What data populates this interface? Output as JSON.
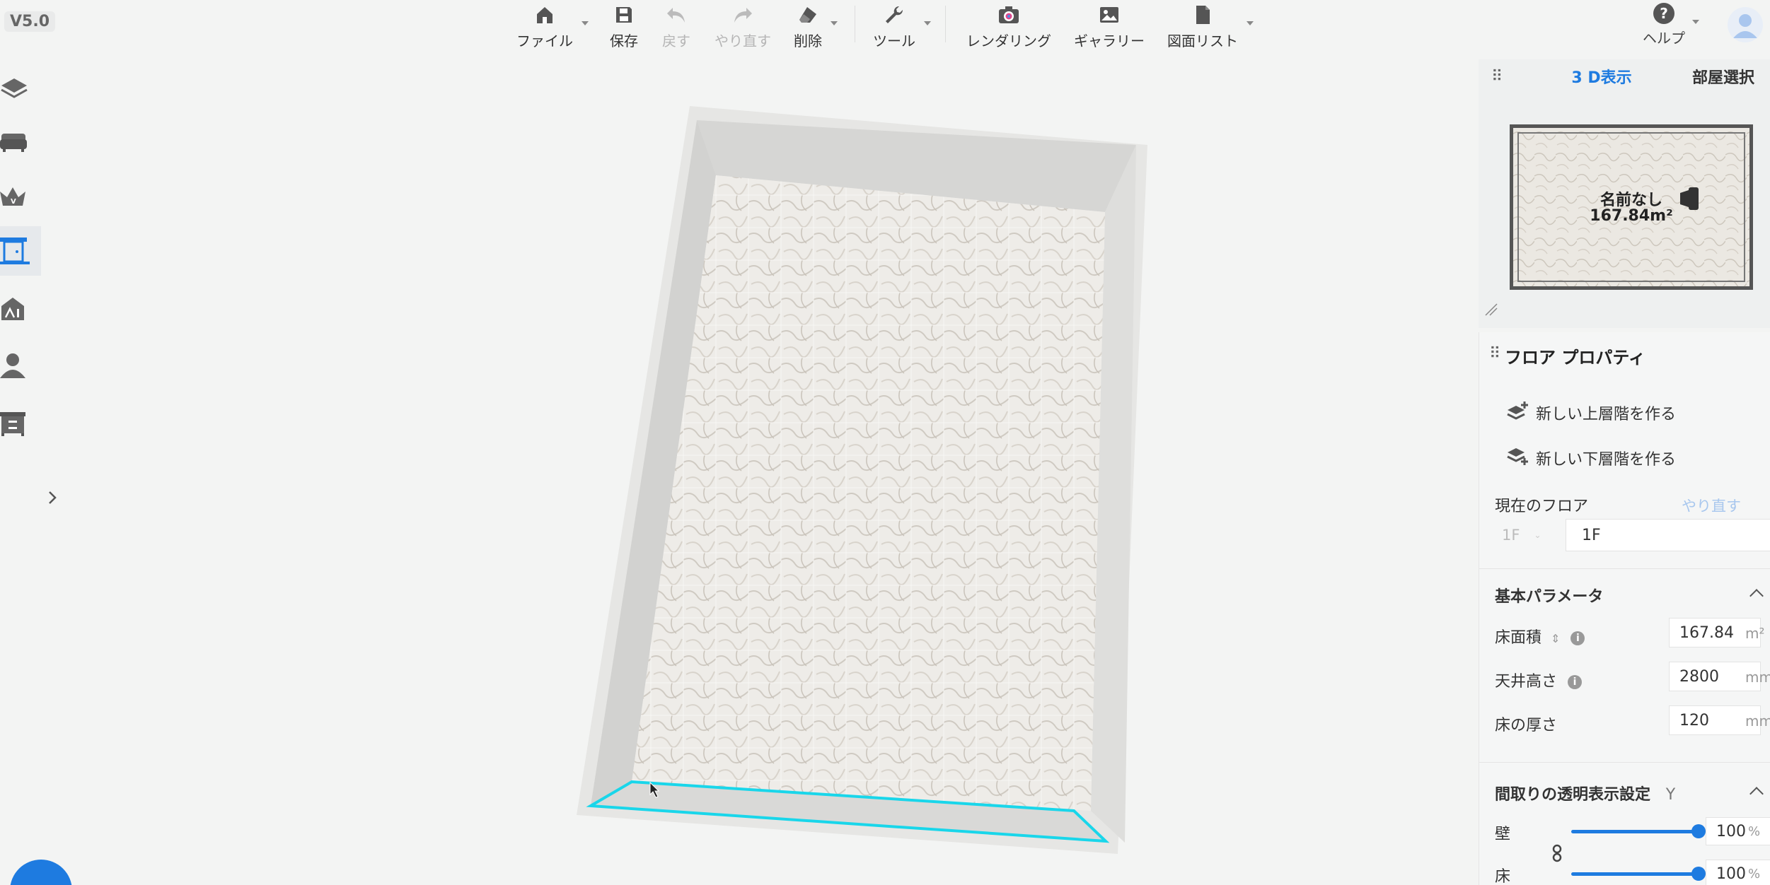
{
  "app": {
    "version": "V5.0"
  },
  "toolbar": {
    "file": "ファイル",
    "save": "保存",
    "undo": "戻す",
    "redo": "やり直す",
    "delete": "削除",
    "tools": "ツール",
    "render": "レンダリング",
    "gallery": "ギャラリー",
    "plans": "図面リスト",
    "help": "ヘルプ"
  },
  "minimap_panel": {
    "tab_3d": "3 D表示",
    "tab_room": "部屋選択",
    "room_name": "名前なし",
    "room_area": "167.84m²"
  },
  "floor_props": {
    "title": "フロア プロパティ",
    "new_upper": "新しい上層階を作る",
    "new_lower": "新しい下層階を作る",
    "current_floor_label": "現在のフロア",
    "redo_link": "やり直す",
    "floor_select": "1F",
    "floor_name": "1F",
    "basic_params": "基本パラメータ",
    "area_label": "床面積",
    "area_value": "167.84",
    "area_unit": "m²",
    "ceiling_label": "天井高さ",
    "ceiling_value": "2800",
    "ceiling_unit": "mm",
    "thickness_label": "床の厚さ",
    "thickness_value": "120",
    "thickness_unit": "mm",
    "transparency_header": "間取りの透明表示設定",
    "transparency_key": "Y",
    "wall_label": "壁",
    "wall_value": "100",
    "floor_label": "床",
    "floor_value": "100",
    "pct_unit": "%"
  },
  "colors": {
    "accent": "#1e7be0",
    "selection": "#19d6ea",
    "wall": "#e2e2e0"
  }
}
